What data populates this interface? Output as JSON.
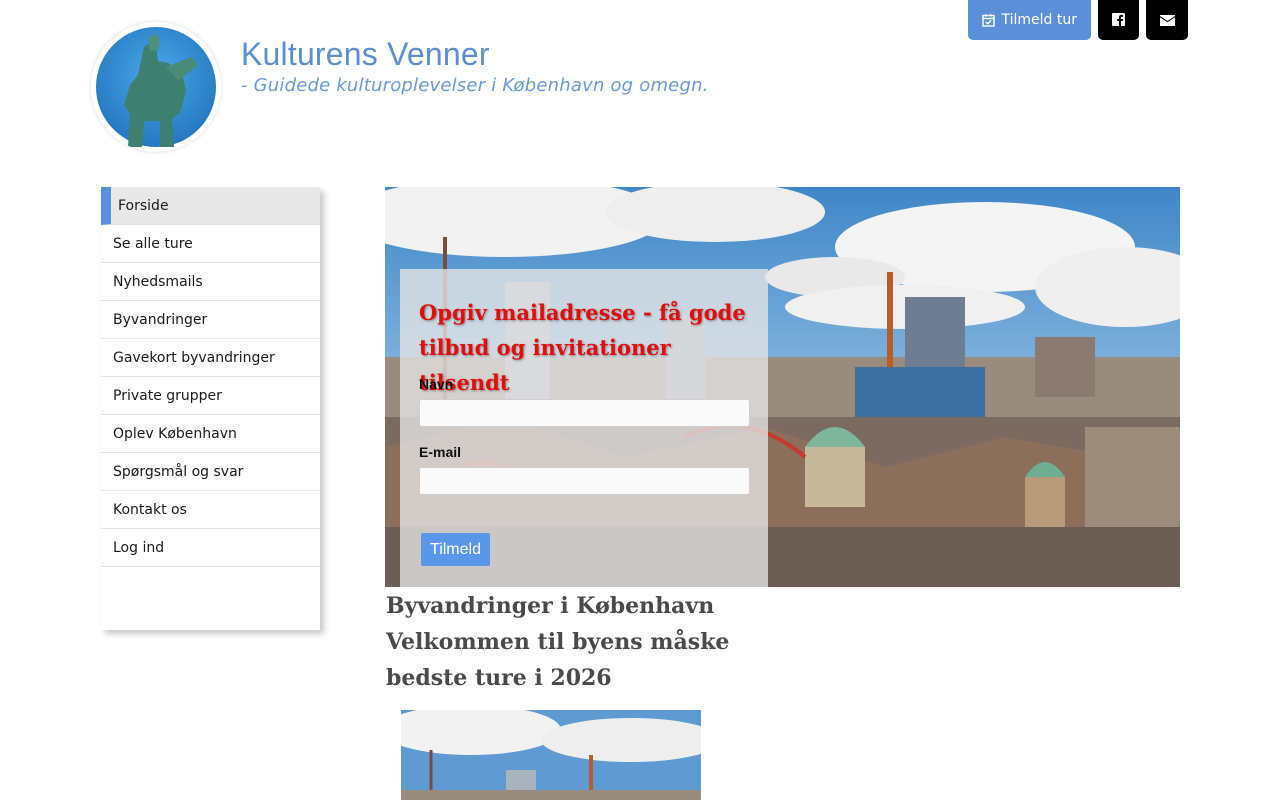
{
  "header": {
    "title": "Kulturens Venner",
    "tagline": "- Guidede kulturoplevelser i København og omegn.",
    "signup_button": "Tilmeld tur",
    "facebook_icon": "facebook-icon",
    "mail_icon": "envelope-icon"
  },
  "sidebar": {
    "items": [
      {
        "label": "Forside",
        "active": true
      },
      {
        "label": "Se alle ture"
      },
      {
        "label": "Nyhedsmails"
      },
      {
        "label": "Byvandringer"
      },
      {
        "label": "Gavekort byvandringer"
      },
      {
        "label": "Private grupper"
      },
      {
        "label": "Oplev København"
      },
      {
        "label": "Spørgsmål og svar"
      },
      {
        "label": "Kontakt os"
      },
      {
        "label": "Log ind"
      }
    ]
  },
  "signup_form": {
    "heading": "Opgiv mailadresse - få gode tilbud og invitationer tilsendt",
    "name_label": "Navn",
    "name_value": "",
    "email_label": "E-mail",
    "email_value": "",
    "submit_label": "Tilmeld"
  },
  "content": {
    "heading_line1": "Byvandringer i København",
    "heading_line2": "Velkommen til byens måske bedste ture i 2026"
  },
  "colors": {
    "accent": "#5b8fd8",
    "title": "#5b8fcf",
    "form_heading": "#e30d0d"
  }
}
